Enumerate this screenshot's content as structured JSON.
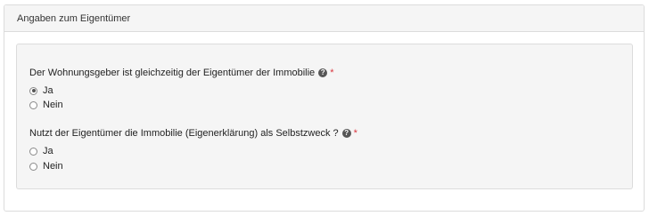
{
  "panel": {
    "title": "Angaben zum Eigentümer"
  },
  "questions": [
    {
      "label": "Der Wohnungsgeber ist gleichzeitig der Eigentümer der Immobilie",
      "help_icon": "question-circle-icon",
      "required_marker": "*",
      "options": [
        {
          "label": "Ja",
          "selected": true
        },
        {
          "label": "Nein",
          "selected": false
        }
      ]
    },
    {
      "label": "Nutzt der Eigentümer die Immobilie (Eigenerklärung) als Selbstzweck ?",
      "help_icon": "question-circle-icon",
      "required_marker": "*",
      "options": [
        {
          "label": "Ja",
          "selected": false
        },
        {
          "label": "Nein",
          "selected": false
        }
      ]
    }
  ],
  "colors": {
    "required": "#d9363e",
    "panel_heading_bg": "#f5f5f5",
    "well_bg": "#f5f5f5",
    "border": "#dcdcdc"
  }
}
